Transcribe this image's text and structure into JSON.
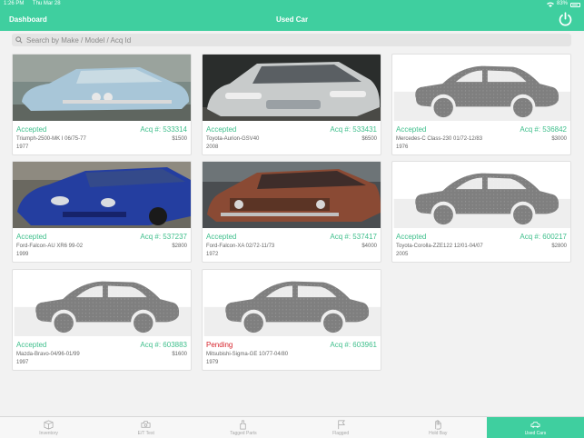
{
  "status_bar": {
    "time": "1:26 PM",
    "date": "Thu Mar 28",
    "battery": "83%"
  },
  "nav": {
    "back_label": "Dashboard",
    "title": "Used Car",
    "power_icon": "power-icon"
  },
  "search": {
    "placeholder": "Search by Make / Model / Acq Id"
  },
  "cars": [
    {
      "status": "Accepted",
      "acq": "Acq #: 533314",
      "model": "Triumph-2500-MK I 06/75-77",
      "price": "$1500",
      "year": "1977",
      "photo": "light-blue"
    },
    {
      "status": "Accepted",
      "acq": "Acq #: 533431",
      "model": "Toyota-Aurion-GSV40",
      "price": "$6500",
      "year": "2008",
      "photo": "silver"
    },
    {
      "status": "Accepted",
      "acq": "Acq #: 536842",
      "model": "Mercedes-C Class-230 01/72-12/83",
      "price": "$3000",
      "year": "1976",
      "photo": "placeholder"
    },
    {
      "status": "Accepted",
      "acq": "Acq #: 537237",
      "model": "Ford-Falcon-AU XR6 99-02",
      "price": "$2800",
      "year": "1999",
      "photo": "blue"
    },
    {
      "status": "Accepted",
      "acq": "Acq #: 537417",
      "model": "Ford-Falcon-XA 02/72-11/73",
      "price": "$4000",
      "year": "1972",
      "photo": "rust"
    },
    {
      "status": "Accepted",
      "acq": "Acq #: 600217",
      "model": "Toyota-Corolla-ZZE122 12/01-04/07",
      "price": "$2800",
      "year": "2005",
      "photo": "placeholder"
    },
    {
      "status": "Accepted",
      "acq": "Acq #: 603883",
      "model": "Mazda-Bravo-04/96-01/99",
      "price": "$1600",
      "year": "1997",
      "photo": "placeholder"
    },
    {
      "status": "Pending",
      "acq": "Acq #: 603961",
      "model": "Mitsubishi-Sigma-GE 10/77-04/80",
      "price": "",
      "year": "1979",
      "photo": "placeholder"
    }
  ],
  "tabs": [
    {
      "label": "Inventory",
      "icon": "box-icon"
    },
    {
      "label": "E/T Test",
      "icon": "engine-icon"
    },
    {
      "label": "Tagged Parts",
      "icon": "tag-hand-icon"
    },
    {
      "label": "Flagged",
      "icon": "flag-icon"
    },
    {
      "label": "Hold Bay",
      "icon": "hand-icon"
    },
    {
      "label": "Used Cars",
      "icon": "car-icon"
    }
  ],
  "colors": {
    "accent": "#3fcf9f",
    "accepted": "#3fbf8c",
    "pending": "#d6242c"
  }
}
